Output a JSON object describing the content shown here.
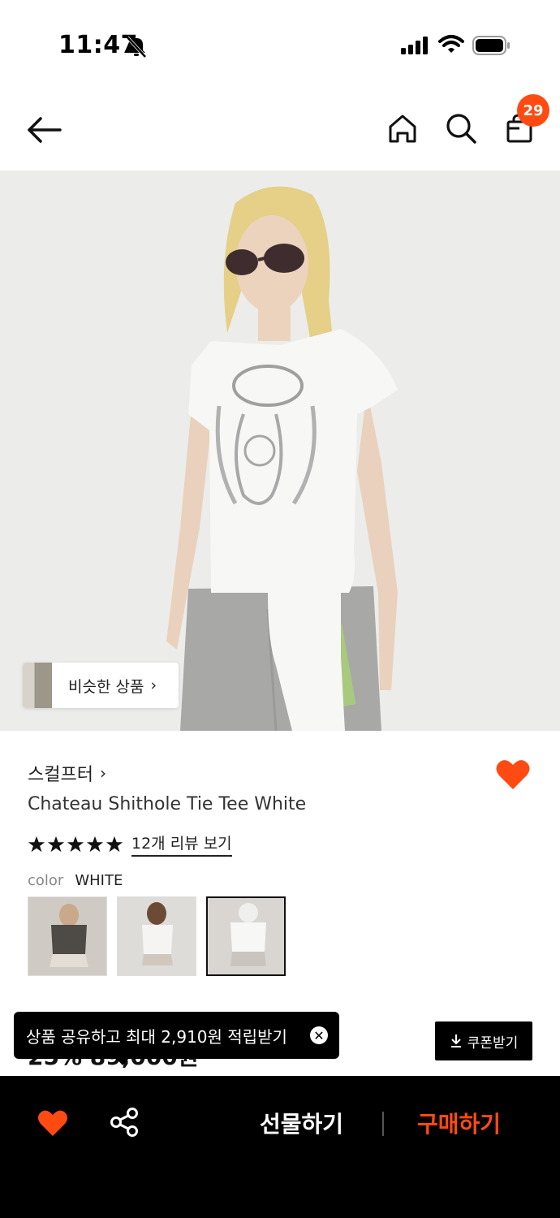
{
  "status_bar": {
    "time": "11:47"
  },
  "header": {
    "cart_count": "29"
  },
  "hero": {
    "similar_label": "비슷한 상품"
  },
  "product": {
    "brand": "스컬프터",
    "name": "Chateau Shithole Tie Tee White",
    "rating_stars": 5,
    "review_link": "12개 리뷰 보기",
    "color_label": "color",
    "color_value": "WHITE",
    "swatches": [
      "black",
      "white",
      "white"
    ],
    "price_partial": "25% 89,000원"
  },
  "share_tooltip": {
    "text": "상품 공유하고 최대 2,910원 적립받기"
  },
  "coupon": {
    "label": "쿠폰받기"
  },
  "bottom_bar": {
    "gift_label": "선물하기",
    "buy_label": "구매하기"
  },
  "colors": {
    "accent": "#ff4b12",
    "dark": "#000000"
  }
}
